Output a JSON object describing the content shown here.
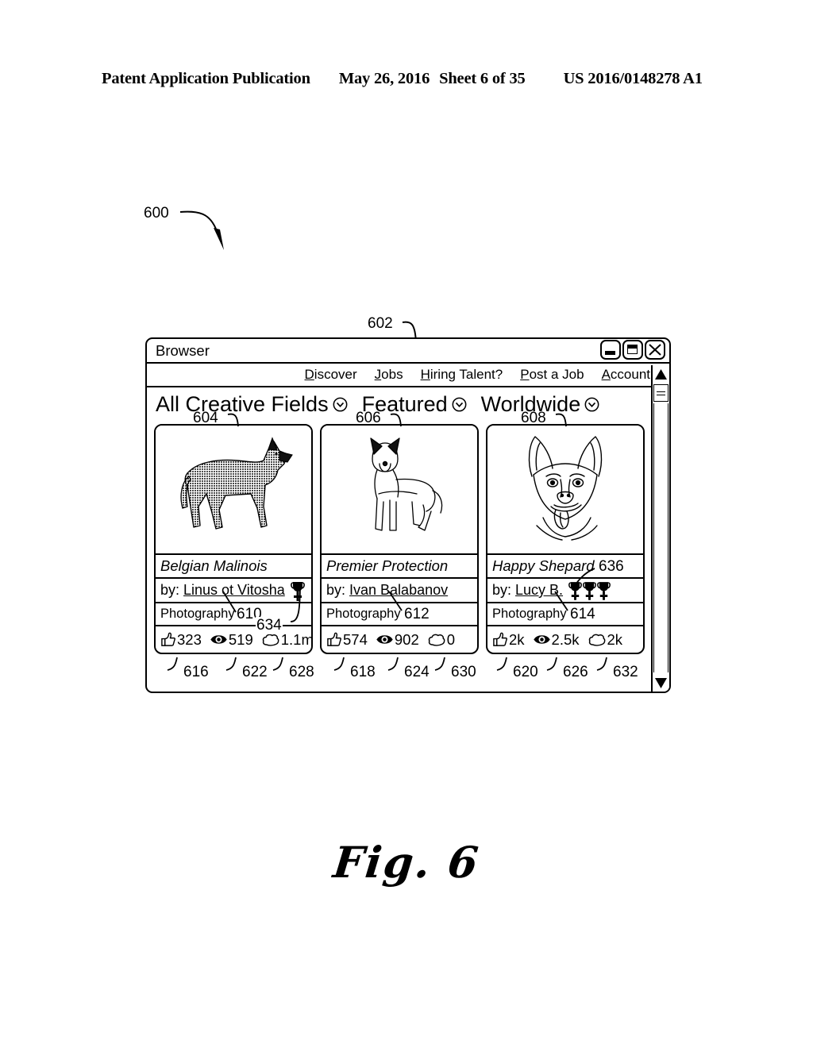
{
  "page_header": {
    "publication": "Patent Application Publication",
    "date": "May 26, 2016",
    "sheet": "Sheet 6 of 35",
    "patent_number": "US 2016/0148278 A1"
  },
  "figure": {
    "caption": "Fig. 6",
    "figure_callout": "600",
    "window_callout": "602"
  },
  "browser": {
    "title": "Browser",
    "window_controls": [
      {
        "name": "minimize-button",
        "glyph": "minimize"
      },
      {
        "name": "maximize-button",
        "glyph": "maximize"
      },
      {
        "name": "close-button",
        "glyph": "close"
      }
    ],
    "nav": [
      {
        "accel": "D",
        "rest": "iscover"
      },
      {
        "accel": "J",
        "rest": "obs"
      },
      {
        "accel": "H",
        "rest": "iring Talent?"
      },
      {
        "accel": "P",
        "rest": "ost a Job"
      },
      {
        "accel": "A",
        "rest": "ccount"
      }
    ],
    "filters": [
      {
        "label": "All Creative Fields",
        "callout": "604",
        "icon": "chevron-down-circle-icon"
      },
      {
        "label": "Featured",
        "callout": "606",
        "icon": "chevron-down-circle-icon"
      },
      {
        "label": "Worldwide",
        "callout": "608",
        "icon": "chevron-down-circle-icon"
      }
    ],
    "scrollbar": {
      "up_arrow": "scroll-up-arrow",
      "down_arrow": "scroll-down-arrow",
      "thumb": "scroll-thumb"
    }
  },
  "cards": [
    {
      "title": "Belgian Malinois",
      "by_label": "by:",
      "author": "Linus ot Vitosha",
      "category": "Photography",
      "trophies": 1,
      "author_callout": "610",
      "trophy_callout": "634",
      "image": "dog-standing-side-halftone",
      "stats": [
        {
          "icon": "thumbs-up-icon",
          "value": "323",
          "callout": "616"
        },
        {
          "icon": "eye-icon",
          "value": "519",
          "callout": "622"
        },
        {
          "icon": "cloud-icon",
          "value": "1.1m",
          "callout": "628"
        }
      ]
    },
    {
      "title": "Premier Protection",
      "by_label": "by:",
      "author": "Ivan Balabanov",
      "category": "Photography",
      "trophies": 0,
      "author_callout": "612",
      "trophy_callout": "",
      "image": "dog-standing-front-sketch",
      "stats": [
        {
          "icon": "thumbs-up-icon",
          "value": "574",
          "callout": "618"
        },
        {
          "icon": "eye-icon",
          "value": "902",
          "callout": "624"
        },
        {
          "icon": "cloud-icon",
          "value": "0",
          "callout": "630"
        }
      ]
    },
    {
      "title": "Happy Shepard",
      "by_label": "by:",
      "author": "Lucy B.",
      "category": "Photography",
      "trophies": 3,
      "author_callout": "614",
      "trophy_callout": "636",
      "image": "dog-face-smiling-sketch",
      "stats": [
        {
          "icon": "thumbs-up-icon",
          "value": "2k",
          "callout": "620"
        },
        {
          "icon": "eye-icon",
          "value": "2.5k",
          "callout": "626"
        },
        {
          "icon": "cloud-icon",
          "value": "2k",
          "callout": "632"
        }
      ]
    }
  ]
}
